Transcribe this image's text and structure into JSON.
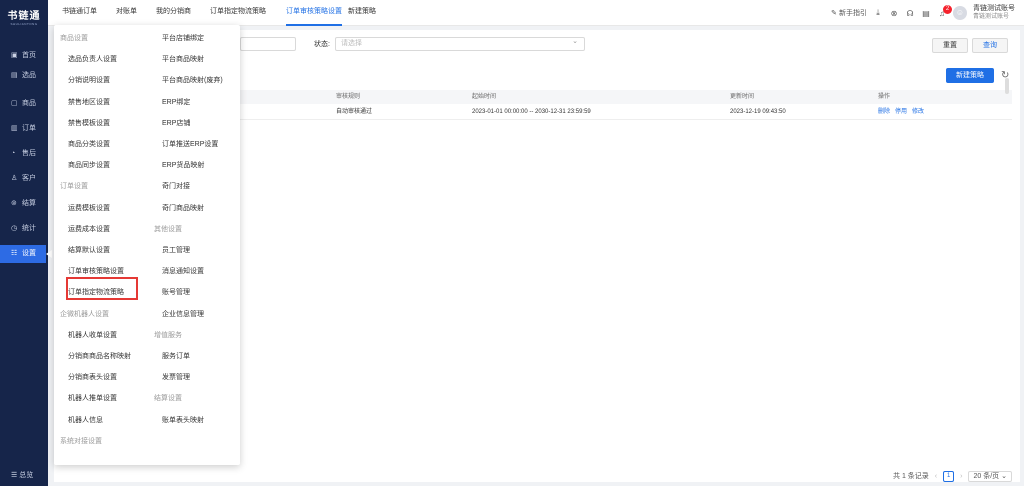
{
  "sidebar": {
    "logo": "书链通",
    "logo_sub": "SHULIANTONG",
    "items": [
      {
        "icon": "▣",
        "label": "首页"
      },
      {
        "icon": "▤",
        "label": "选品"
      },
      {
        "icon": "▢",
        "label": "商品"
      },
      {
        "icon": "▥",
        "label": "订单"
      },
      {
        "icon": "◔",
        "label": "售后"
      },
      {
        "icon": "♙",
        "label": "客户"
      },
      {
        "icon": "⊚",
        "label": "结算"
      },
      {
        "icon": "◷",
        "label": "统计"
      },
      {
        "icon": "☷",
        "label": "设置"
      }
    ],
    "footer": "☰ 总览"
  },
  "topbar": {
    "tabs": [
      "书链通订单",
      "对账单",
      "我的分销商",
      "订单指定物流策略",
      "订单审核策略设置",
      "新建策略"
    ],
    "guide": "新手指引",
    "badge": "2",
    "account_name": "青链测试账号",
    "account_sub": "青链测试账号"
  },
  "filter": {
    "status_label": "状态:",
    "status_placeholder": "请选择",
    "reset": "重置",
    "search": "查询"
  },
  "toolbar": {
    "new_policy": "新建策略"
  },
  "table": {
    "headers": [
      "审核规则",
      "起始时间",
      "更新时间",
      "操作"
    ],
    "rows": [
      {
        "rule": "自动审核通过",
        "start": "2023-01-01 00:00:00 -- 2030-12-31 23:59:59",
        "updated": "2023-12-19 09:43:50",
        "ops": [
          "删除",
          "停用",
          "修改"
        ]
      }
    ]
  },
  "pager": {
    "total": "共 1 条记录",
    "page": "1",
    "size": "20 条/页"
  },
  "menu": {
    "col1": [
      {
        "t": "商品设置",
        "g": true
      },
      {
        "t": "选品负责人设置"
      },
      {
        "t": "分销说明设置"
      },
      {
        "t": "禁售地区设置"
      },
      {
        "t": "禁售模板设置"
      },
      {
        "t": "商品分类设置"
      },
      {
        "t": "商品同步设置"
      },
      {
        "t": "订单设置",
        "g": true
      },
      {
        "t": "运费模板设置"
      },
      {
        "t": "运费成本设置"
      },
      {
        "t": "结算默认设置"
      },
      {
        "t": "订单审核策略设置"
      },
      {
        "t": "订单指定物流策略"
      },
      {
        "t": "企微机器人设置",
        "g": true
      },
      {
        "t": "机器人收单设置"
      },
      {
        "t": "分销商商品名称映射"
      },
      {
        "t": "分销商表头设置"
      },
      {
        "t": "机器人推单设置"
      },
      {
        "t": "机器人信息"
      },
      {
        "t": "系统对接设置",
        "g": true
      }
    ],
    "col2": [
      {
        "t": "平台店铺绑定"
      },
      {
        "t": "平台商品映射"
      },
      {
        "t": "平台商品映射(废弃)"
      },
      {
        "t": "ERP绑定"
      },
      {
        "t": "ERP店铺"
      },
      {
        "t": "订单推送ERP设置"
      },
      {
        "t": "ERP货品映射"
      },
      {
        "t": "奇门对接"
      },
      {
        "t": "奇门商品映射"
      },
      {
        "t": "其他设置",
        "g": true
      },
      {
        "t": "员工管理"
      },
      {
        "t": "消息通知设置"
      },
      {
        "t": "账号管理"
      },
      {
        "t": "企业信息管理"
      },
      {
        "t": "增值服务",
        "g": true
      },
      {
        "t": "服务订单"
      },
      {
        "t": "发票管理"
      },
      {
        "t": "结算设置",
        "g": true
      },
      {
        "t": "账单表头映射"
      }
    ]
  }
}
